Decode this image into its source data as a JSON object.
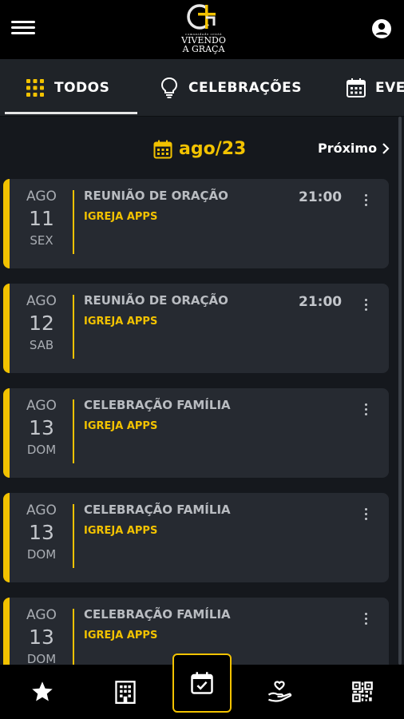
{
  "header": {
    "logo_line1": "comunidade cristã",
    "logo_line2": "VIVENDO",
    "logo_line3": "A GRAÇA",
    "menu_icon": "hamburger-menu-icon",
    "account_icon": "account-circle-icon"
  },
  "tabs": [
    {
      "label": "TODOS",
      "icon": "grid-icon",
      "active": true
    },
    {
      "label": "CELEBRAÇÕES",
      "icon": "lightbulb-icon",
      "active": false
    },
    {
      "label": "EVE",
      "icon": "calendar-icon",
      "active": false
    }
  ],
  "month": {
    "label": "ago/23",
    "icon": "calendar-icon",
    "next_label": "Próximo"
  },
  "colors": {
    "accent": "#f2c200",
    "background": "#15181d",
    "card": "#262a31",
    "topbar": "#000000"
  },
  "events": [
    {
      "month": "AGO",
      "day": "11",
      "weekday": "SEX",
      "title": "REUNIÃO DE ORAÇÃO",
      "org": "IGREJA APPS",
      "time": "21:00"
    },
    {
      "month": "AGO",
      "day": "12",
      "weekday": "SAB",
      "title": "REUNIÃO DE ORAÇÃO",
      "org": "IGREJA APPS",
      "time": "21:00"
    },
    {
      "month": "AGO",
      "day": "13",
      "weekday": "DOM",
      "title": "CELEBRAÇÃO FAMÍLIA",
      "org": "IGREJA APPS",
      "time": ""
    },
    {
      "month": "AGO",
      "day": "13",
      "weekday": "DOM",
      "title": "CELEBRAÇÃO FAMÍLIA",
      "org": "IGREJA APPS",
      "time": ""
    },
    {
      "month": "AGO",
      "day": "13",
      "weekday": "DOM",
      "title": "CELEBRAÇÃO FAMÍLIA",
      "org": "IGREJA APPS",
      "time": ""
    }
  ],
  "bottom_nav": [
    {
      "icon": "star-icon",
      "active": false
    },
    {
      "icon": "building-icon",
      "active": false
    },
    {
      "icon": "calendar-check-icon",
      "active": true
    },
    {
      "icon": "donation-hand-icon",
      "active": false
    },
    {
      "icon": "qr-code-icon",
      "active": false
    }
  ]
}
